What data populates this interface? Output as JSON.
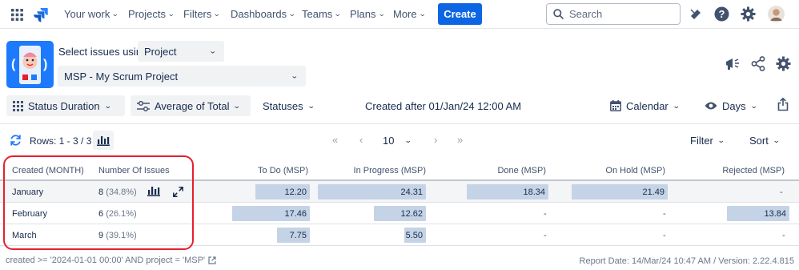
{
  "nav": {
    "items": [
      "Your work",
      "Projects",
      "Filters",
      "Dashboards",
      "Teams",
      "Plans",
      "More"
    ],
    "create_label": "Create",
    "search_placeholder": "Search"
  },
  "selector": {
    "select_issues_label": "Select issues using",
    "source_value": "Project",
    "project_value": "MSP - My Scrum Project"
  },
  "toolbar": {
    "status_duration": "Status Duration",
    "average_of_total": "Average of Total",
    "statuses": "Statuses",
    "created_filter": "Created after 01/Jan/24 12:00 AM",
    "calendar": "Calendar",
    "days": "Days"
  },
  "pagination": {
    "rows_label": "Rows: 1 - 3 / 3",
    "page_size": "10",
    "filter": "Filter",
    "sort": "Sort"
  },
  "table": {
    "headers": [
      "Created (MONTH)",
      "Number Of Issues",
      "To Do (MSP)",
      "In Progress (MSP)",
      "Done (MSP)",
      "On Hold (MSP)",
      "Rejected (MSP)"
    ],
    "rows": [
      {
        "month": "January",
        "count": "8",
        "pct": "(34.8%)",
        "cells": [
          "12.20",
          "24.31",
          "18.34",
          "21.49",
          "-"
        ]
      },
      {
        "month": "February",
        "count": "6",
        "pct": "(26.1%)",
        "cells": [
          "17.46",
          "12.62",
          "-",
          "-",
          "13.84"
        ]
      },
      {
        "month": "March",
        "count": "9",
        "pct": "(39.1%)",
        "cells": [
          "7.75",
          "5.50",
          "-",
          "-",
          "-"
        ]
      }
    ]
  },
  "footer": {
    "jql": "created >= '2024-01-01 00:00' AND project = 'MSP'",
    "report_info": "Report Date: 14/Mar/24 10:47 AM / Version: 2.22.4.815"
  },
  "colors": {
    "accent": "#0c66e4",
    "bar": "#c5d3e6",
    "highlight": "#e5202e"
  }
}
